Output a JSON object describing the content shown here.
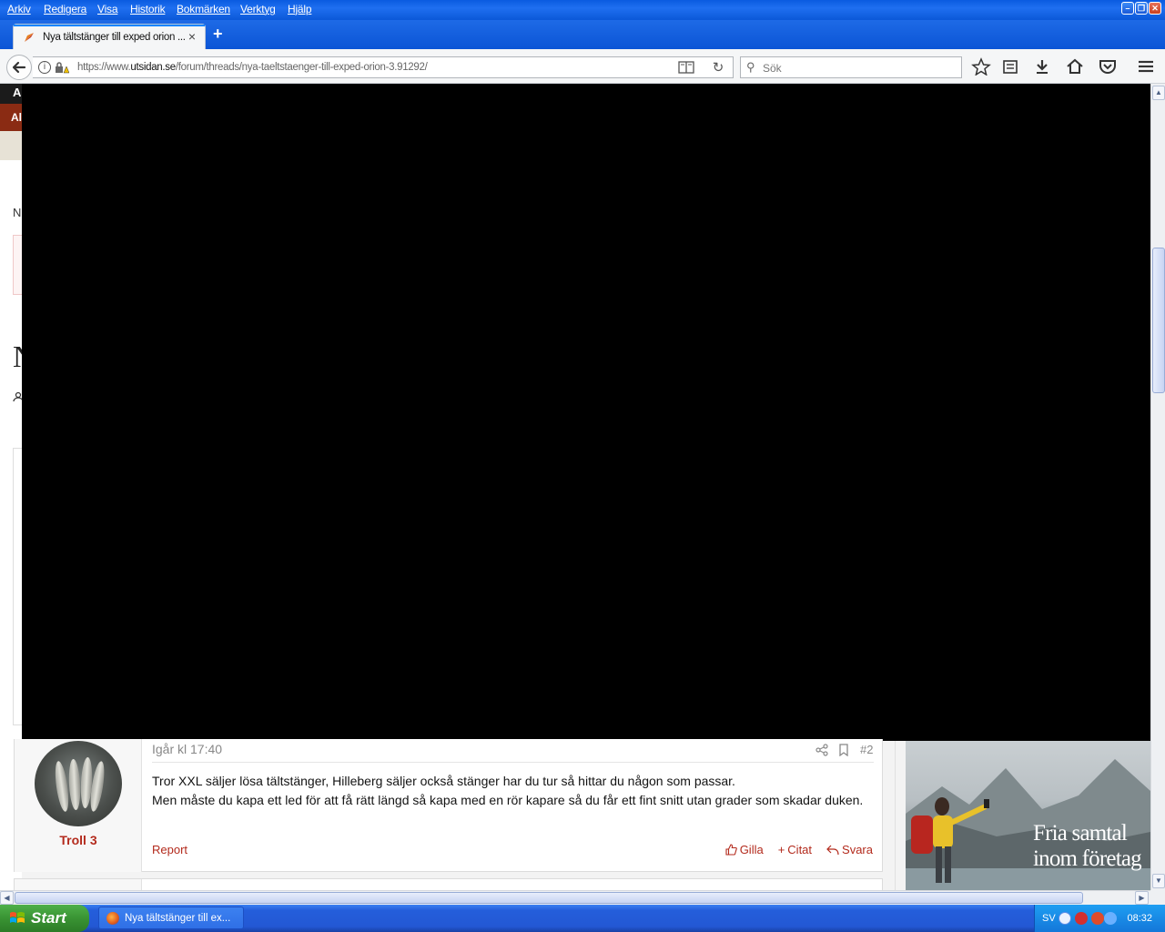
{
  "menubar": {
    "items": [
      "Arkiv",
      "Redigera",
      "Visa",
      "Historik",
      "Bokmärken",
      "Verktyg",
      "Hjälp"
    ]
  },
  "tab": {
    "title": "Nya tältstänger till exped orion ...",
    "close": "×",
    "new_tab": "+"
  },
  "nav": {
    "url_prefix": "https://www.",
    "url_domain": "utsidan.se",
    "url_path": "/forum/threads/nya-taeltstaenger-till-exped-orion-3.91292/",
    "search_placeholder": "Sök",
    "reload": "↻"
  },
  "page_left": {
    "strip_dark": "A",
    "strip_red": "Al",
    "n_letter": "N",
    "big_letter": "N"
  },
  "post": {
    "date": "Igår kl 17:40",
    "number": "#2",
    "username": "Troll 3",
    "body_lines": [
      "Tror XXL säljer lösa tältstänger, Hilleberg säljer också stänger har du tur så hittar du någon som passar.",
      "Men måste du kapa ett led för att få rätt längd så kapa med en rör kapare så du får ett fint snitt utan grader som skadar duken."
    ],
    "report": "Report",
    "like": "Gilla",
    "quote": "Citat",
    "reply": "Svara"
  },
  "ad": {
    "headline_line1": "Fria samtal",
    "headline_line2": "inom företag"
  },
  "taskbar": {
    "start": "Start",
    "task_title": "Nya tältstänger till ex...",
    "lang": "SV",
    "clock": "08:32"
  },
  "colors": {
    "accent_red": "#b32a1c",
    "xp_blue": "#0b58d8",
    "start_green": "#399333"
  }
}
